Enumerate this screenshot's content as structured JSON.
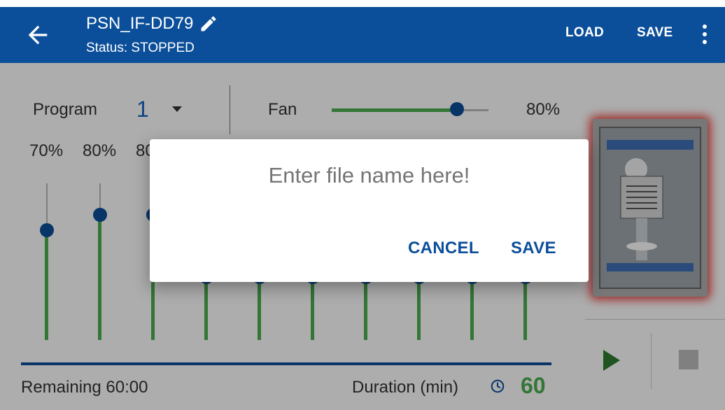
{
  "appbar": {
    "title": "PSN_IF-DD79",
    "status": "Status: STOPPED",
    "load_label": "LOAD",
    "save_label": "SAVE"
  },
  "program": {
    "label": "Program",
    "value": "1"
  },
  "fan": {
    "label": "Fan",
    "percent_text": "80%",
    "level": 0.8
  },
  "channels": [
    {
      "pct": "70%",
      "level": 0.7
    },
    {
      "pct": "80%",
      "level": 0.8
    },
    {
      "pct": "80%",
      "level": 0.8
    },
    {
      "level": 0.4
    },
    {
      "level": 0.4
    },
    {
      "level": 0.4
    },
    {
      "level": 0.4
    },
    {
      "level": 0.4
    },
    {
      "level": 0.4
    },
    {
      "level": 0.4
    }
  ],
  "footer": {
    "remaining": "Remaining 60:00",
    "duration_label": "Duration (min)",
    "duration_value": "60"
  },
  "dialog": {
    "placeholder": "Enter file name here!",
    "cancel_label": "CANCEL",
    "save_label": "SAVE"
  },
  "colors": {
    "primary": "#0b4f9a",
    "accent_green": "#4caf50",
    "highlight_red": "#e53935"
  },
  "icons": [
    "back-arrow-icon",
    "pencil-icon",
    "more-vert-icon",
    "dropdown-caret-icon",
    "clock-icon",
    "play-icon",
    "stop-icon"
  ]
}
